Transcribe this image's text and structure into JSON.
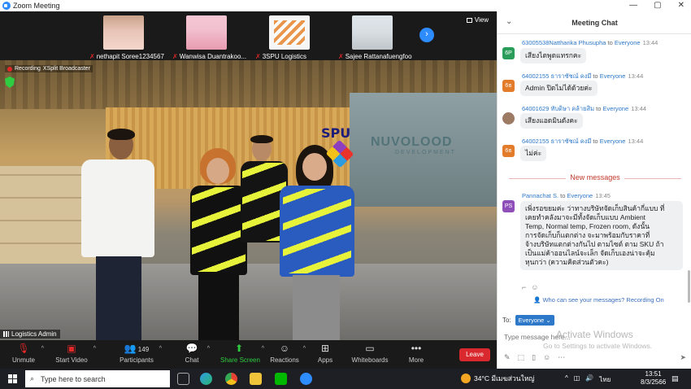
{
  "window": {
    "title": "Zoom Meeting",
    "minimize": "—",
    "maximize": "▢",
    "close": "✕"
  },
  "participants": [
    {
      "name": "nethapit Soree1234567",
      "color": "#e8c4b8"
    },
    {
      "name": "Wanwisa Duantrakoo...",
      "color": "#f2c0cf"
    },
    {
      "name": "3SPU Logistics",
      "color": "#f6f6f6"
    },
    {
      "name": "Sajee Rattanafuengfoo",
      "color": "#d8dde2"
    }
  ],
  "view_label": "View",
  "recording": {
    "label": "Recording",
    "sub": "XSplit Broadcaster"
  },
  "overlay": {
    "spu": "SPU",
    "brand": "NUVOLOOD",
    "brand_sub": "DEVELOPMENT"
  },
  "active_speaker": "Logistics Admin",
  "toolbar": {
    "unmute": "Unmute",
    "start_video": "Start Video",
    "participants": "Participants",
    "participant_count": "149",
    "chat": "Chat",
    "share_screen": "Share Screen",
    "reactions": "Reactions",
    "apps": "Apps",
    "whiteboards": "Whiteboards",
    "more": "More",
    "leave": "Leave"
  },
  "chat": {
    "title": "Meeting Chat",
    "new_messages": "New messages",
    "messages": [
      {
        "avatar": "6P",
        "avatar_color": "#2a9d5b",
        "sender": "63005538Nattharika Phusupha",
        "to": "to",
        "recipient": "Everyone",
        "time": "13:44",
        "text": "เสียงไดพูดแทรกคะ"
      },
      {
        "avatar": "6ธ",
        "avatar_color": "#e27b2a",
        "sender": "64002155 ธาราชัชณ์ คงมี",
        "to": "to",
        "recipient": "Everyone",
        "time": "13:44",
        "text": "Admin ปิดไม่ได้ด้วยค่ะ"
      },
      {
        "avatar": "",
        "avatar_color": "#9c7a64",
        "sender": "64001629 ทับดิษา คล้ายสิม",
        "to": "to",
        "recipient": "Everyone",
        "time": "13:44",
        "text": "เสียงแอดมินดังคะ"
      },
      {
        "avatar": "6ธ",
        "avatar_color": "#e27b2a",
        "sender": "64002155 ธาราชัชณ์ คงมี",
        "to": "to",
        "recipient": "Everyone",
        "time": "13:44",
        "text": "ไม่ค่ะ"
      },
      {
        "avatar": "PS",
        "avatar_color": "#8e4fb8",
        "sender": "Pannachat S.",
        "to": "to",
        "recipient": "Everyone",
        "time": "13:45",
        "lines": [
          "เพิ่งรอขยมค่ะ ว่าทางบริษัทจัดเก็บสินค้ากี่แบบ ที่",
          "เคยทำคลังมาจะมีทั้งจัดเก็บแบบ Ambient",
          "Temp, Normal temp, Frozen room, ดังนั้น",
          "การจัดเก็บก็แตกต่าง จะมาพร้อมกับราคาที่",
          "จ้างบริษัทแตกต่างกันไป ตามไซต์ ตาม SKU ถ้า",
          "เป็นแม่ค้าออนไลน์จะเล็ก จัดเก็บเองน่าจะคุ้ม",
          "หุนกว่า (ความคิดส่วนตัวคะ)"
        ]
      }
    ],
    "privacy_note": "Who can see your messages? Recording On",
    "to_label": "To:",
    "to_value": "Everyone",
    "input_placeholder": "Type message here...",
    "watermark_title": "Activate Windows",
    "watermark_sub": "Go to Settings to activate Windows."
  },
  "taskbar": {
    "search_placeholder": "Type here to search",
    "weather": "34°C มีเมฆส่วนใหญ่",
    "lang": "ไทย",
    "time": "13:51",
    "date": "8/3/2566"
  }
}
